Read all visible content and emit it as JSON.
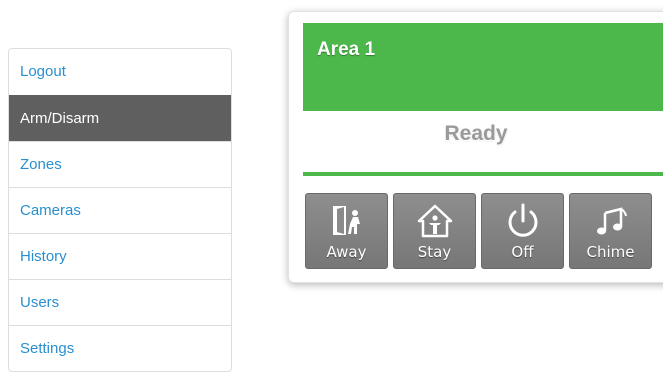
{
  "sidebar": {
    "items": [
      {
        "label": "Logout"
      },
      {
        "label": "Arm/Disarm"
      },
      {
        "label": "Zones"
      },
      {
        "label": "Cameras"
      },
      {
        "label": "History"
      },
      {
        "label": "Users"
      },
      {
        "label": "Settings"
      }
    ],
    "active_item": "Arm/Disarm"
  },
  "area": {
    "title": "Area 1",
    "status": "Ready",
    "status_color": "#4cb84c",
    "buttons": [
      {
        "label": "Away",
        "icon": "away-door-person-icon"
      },
      {
        "label": "Stay",
        "icon": "stay-house-person-icon"
      },
      {
        "label": "Off",
        "icon": "power-icon"
      },
      {
        "label": "Chime",
        "icon": "music-notes-icon"
      }
    ]
  },
  "colors": {
    "accent_green": "#4cb84c",
    "link_blue": "#2a8fd0",
    "active_nav_bg": "#5f5f5f",
    "button_gray": "#838383"
  }
}
